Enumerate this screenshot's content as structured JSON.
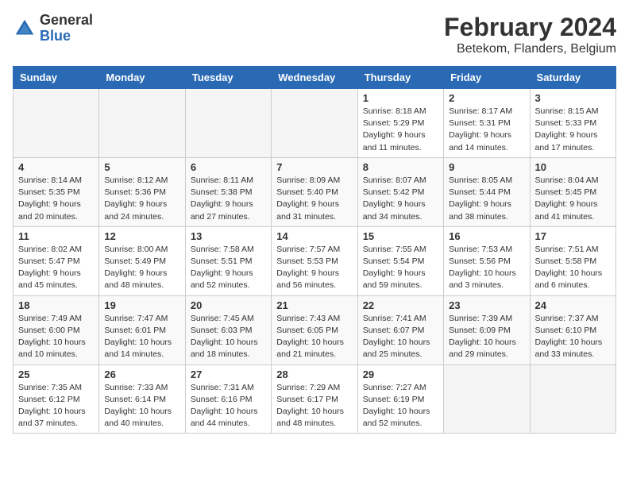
{
  "header": {
    "logo_general": "General",
    "logo_blue": "Blue",
    "title": "February 2024",
    "subtitle": "Betekom, Flanders, Belgium"
  },
  "days_of_week": [
    "Sunday",
    "Monday",
    "Tuesday",
    "Wednesday",
    "Thursday",
    "Friday",
    "Saturday"
  ],
  "weeks": [
    [
      {
        "day": "",
        "info": ""
      },
      {
        "day": "",
        "info": ""
      },
      {
        "day": "",
        "info": ""
      },
      {
        "day": "",
        "info": ""
      },
      {
        "day": "1",
        "info": "Sunrise: 8:18 AM\nSunset: 5:29 PM\nDaylight: 9 hours\nand 11 minutes."
      },
      {
        "day": "2",
        "info": "Sunrise: 8:17 AM\nSunset: 5:31 PM\nDaylight: 9 hours\nand 14 minutes."
      },
      {
        "day": "3",
        "info": "Sunrise: 8:15 AM\nSunset: 5:33 PM\nDaylight: 9 hours\nand 17 minutes."
      }
    ],
    [
      {
        "day": "4",
        "info": "Sunrise: 8:14 AM\nSunset: 5:35 PM\nDaylight: 9 hours\nand 20 minutes."
      },
      {
        "day": "5",
        "info": "Sunrise: 8:12 AM\nSunset: 5:36 PM\nDaylight: 9 hours\nand 24 minutes."
      },
      {
        "day": "6",
        "info": "Sunrise: 8:11 AM\nSunset: 5:38 PM\nDaylight: 9 hours\nand 27 minutes."
      },
      {
        "day": "7",
        "info": "Sunrise: 8:09 AM\nSunset: 5:40 PM\nDaylight: 9 hours\nand 31 minutes."
      },
      {
        "day": "8",
        "info": "Sunrise: 8:07 AM\nSunset: 5:42 PM\nDaylight: 9 hours\nand 34 minutes."
      },
      {
        "day": "9",
        "info": "Sunrise: 8:05 AM\nSunset: 5:44 PM\nDaylight: 9 hours\nand 38 minutes."
      },
      {
        "day": "10",
        "info": "Sunrise: 8:04 AM\nSunset: 5:45 PM\nDaylight: 9 hours\nand 41 minutes."
      }
    ],
    [
      {
        "day": "11",
        "info": "Sunrise: 8:02 AM\nSunset: 5:47 PM\nDaylight: 9 hours\nand 45 minutes."
      },
      {
        "day": "12",
        "info": "Sunrise: 8:00 AM\nSunset: 5:49 PM\nDaylight: 9 hours\nand 48 minutes."
      },
      {
        "day": "13",
        "info": "Sunrise: 7:58 AM\nSunset: 5:51 PM\nDaylight: 9 hours\nand 52 minutes."
      },
      {
        "day": "14",
        "info": "Sunrise: 7:57 AM\nSunset: 5:53 PM\nDaylight: 9 hours\nand 56 minutes."
      },
      {
        "day": "15",
        "info": "Sunrise: 7:55 AM\nSunset: 5:54 PM\nDaylight: 9 hours\nand 59 minutes."
      },
      {
        "day": "16",
        "info": "Sunrise: 7:53 AM\nSunset: 5:56 PM\nDaylight: 10 hours\nand 3 minutes."
      },
      {
        "day": "17",
        "info": "Sunrise: 7:51 AM\nSunset: 5:58 PM\nDaylight: 10 hours\nand 6 minutes."
      }
    ],
    [
      {
        "day": "18",
        "info": "Sunrise: 7:49 AM\nSunset: 6:00 PM\nDaylight: 10 hours\nand 10 minutes."
      },
      {
        "day": "19",
        "info": "Sunrise: 7:47 AM\nSunset: 6:01 PM\nDaylight: 10 hours\nand 14 minutes."
      },
      {
        "day": "20",
        "info": "Sunrise: 7:45 AM\nSunset: 6:03 PM\nDaylight: 10 hours\nand 18 minutes."
      },
      {
        "day": "21",
        "info": "Sunrise: 7:43 AM\nSunset: 6:05 PM\nDaylight: 10 hours\nand 21 minutes."
      },
      {
        "day": "22",
        "info": "Sunrise: 7:41 AM\nSunset: 6:07 PM\nDaylight: 10 hours\nand 25 minutes."
      },
      {
        "day": "23",
        "info": "Sunrise: 7:39 AM\nSunset: 6:09 PM\nDaylight: 10 hours\nand 29 minutes."
      },
      {
        "day": "24",
        "info": "Sunrise: 7:37 AM\nSunset: 6:10 PM\nDaylight: 10 hours\nand 33 minutes."
      }
    ],
    [
      {
        "day": "25",
        "info": "Sunrise: 7:35 AM\nSunset: 6:12 PM\nDaylight: 10 hours\nand 37 minutes."
      },
      {
        "day": "26",
        "info": "Sunrise: 7:33 AM\nSunset: 6:14 PM\nDaylight: 10 hours\nand 40 minutes."
      },
      {
        "day": "27",
        "info": "Sunrise: 7:31 AM\nSunset: 6:16 PM\nDaylight: 10 hours\nand 44 minutes."
      },
      {
        "day": "28",
        "info": "Sunrise: 7:29 AM\nSunset: 6:17 PM\nDaylight: 10 hours\nand 48 minutes."
      },
      {
        "day": "29",
        "info": "Sunrise: 7:27 AM\nSunset: 6:19 PM\nDaylight: 10 hours\nand 52 minutes."
      },
      {
        "day": "",
        "info": ""
      },
      {
        "day": "",
        "info": ""
      }
    ]
  ]
}
